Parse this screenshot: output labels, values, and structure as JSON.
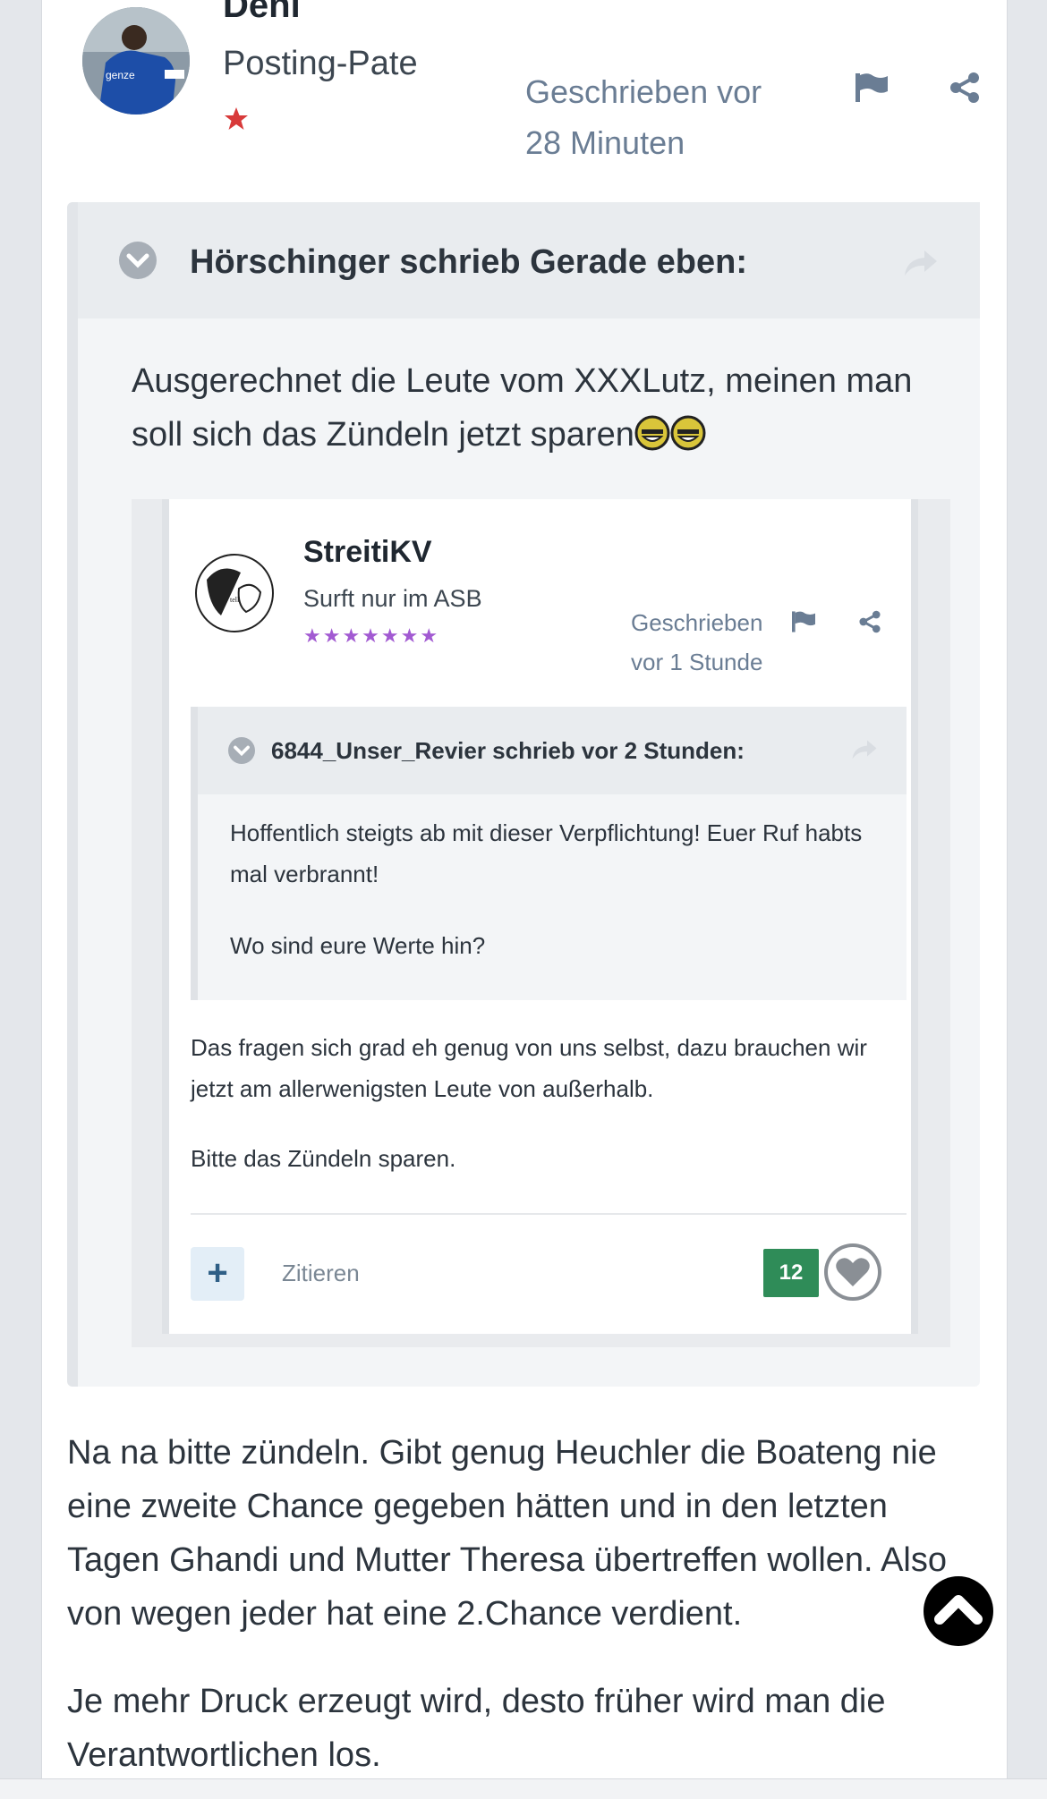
{
  "post": {
    "author": "Deni",
    "rank": "Posting-Pate",
    "meta_line1": "Geschrieben vor",
    "meta_line2": "28 Minuten",
    "avatar_text": "genze"
  },
  "quote": {
    "title": "Hörschinger schrieb Gerade eben:",
    "text": "Ausgerechnet die Leute vom XXXLutz, meinen man soll sich das Zündeln jetzt sparen"
  },
  "embedded": {
    "author": "StreitiKV",
    "rank": "Surft nur im ASB",
    "stars": "★★★★★★★",
    "meta_line1": "Geschrieben",
    "meta_line2": "vor 1 Stunde",
    "inner_quote_title": "6844_Unser_Revier schrieb vor 2 Stunden:",
    "inner_quote_text1": "Hoffentlich steigts ab mit dieser Verpflichtung! Euer Ruf habts mal verbrannt!",
    "inner_quote_text2": "Wo sind eure Werte hin?",
    "body1": "Das fragen sich grad eh genug von uns selbst, dazu brauchen wir jetzt am allerwenigsten Leute von außerhalb.",
    "body2": "Bitte das Zündeln sparen.",
    "plus": "+",
    "cite": "Zitieren",
    "reactions": "12"
  },
  "body": {
    "paragraph1": "Na na bitte zündeln. Gibt genug Heuchler die Boateng nie eine zweite Chance gegeben hätten und in den letzten Tagen Ghandi und Mutter Theresa übertreffen wollen. Also von wegen jeder hat eine 2.Chance verdient.",
    "paragraph2": "Je mehr Druck erzeugt wird, desto früher wird man die Verantwortlichen los."
  },
  "colors": {
    "meta": "#6a7d94",
    "reaction_badge": "#2f8c58",
    "star_rank": "#d83a3a",
    "stars_embedded": "#a25ad2"
  },
  "icons": [
    "flag-icon",
    "share-icon",
    "chevron-down-icon",
    "reply-arrow-icon",
    "heart-icon",
    "emoji-grin-icon",
    "chevron-up-icon"
  ]
}
